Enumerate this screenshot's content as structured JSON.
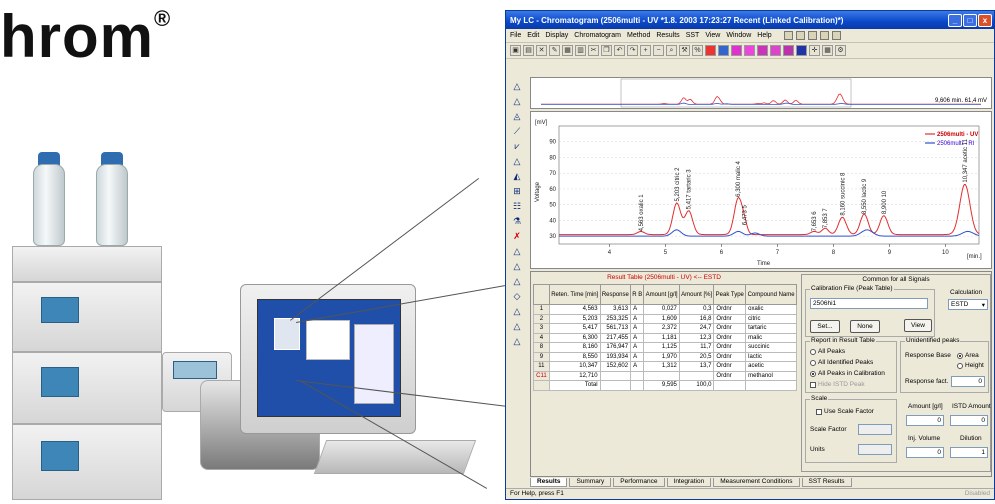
{
  "brand": {
    "text": "hrom",
    "mark": "®"
  },
  "window": {
    "title": "My LC - Chromatogram (2506multi  - UV *1.8. 2003 17:23:27 Recent (Linked Calibration)*)",
    "controls": [
      "_",
      "□",
      "x"
    ]
  },
  "menu": [
    "File",
    "Edit",
    "Display",
    "Chromatogram",
    "Method",
    "Results",
    "SST",
    "View",
    "Window",
    "Help"
  ],
  "overview": {
    "readout": "9,606 min.  61,4 mV"
  },
  "chart_data": {
    "type": "line",
    "ylabel": "Voltage",
    "xlabel": "Time",
    "yunit": "[mV]",
    "xunit": "[min.]",
    "xlim": [
      3.1,
      10.6
    ],
    "ylim": [
      25,
      100
    ],
    "xticks": [
      4,
      5,
      6,
      7,
      8,
      9,
      10
    ],
    "yticks": [
      30,
      40,
      50,
      60,
      70,
      80,
      90
    ],
    "legend": [
      "2506multi - UV",
      "2506multi - RI"
    ],
    "series": [
      {
        "name": "2506multi - UV",
        "color": "#e03030",
        "baseline": 31,
        "peaks": [
          [
            4.563,
            2,
            0.06
          ],
          [
            5.203,
            20,
            0.07
          ],
          [
            5.417,
            15,
            0.07
          ],
          [
            6.3,
            23,
            0.07
          ],
          [
            6.41,
            6,
            0.05
          ],
          [
            7.653,
            2,
            0.06
          ],
          [
            7.853,
            4,
            0.06
          ],
          [
            8.16,
            11,
            0.07
          ],
          [
            8.55,
            13,
            0.07
          ],
          [
            8.9,
            12,
            0.07
          ],
          [
            10.347,
            32,
            0.09
          ]
        ]
      },
      {
        "name": "2506multi - RI",
        "color": "#3050d0",
        "baseline": 30,
        "peaks": [
          [
            5.2,
            4,
            0.08
          ],
          [
            6.3,
            3,
            0.08
          ],
          [
            6.6,
            2,
            0.08
          ],
          [
            8.6,
            4,
            0.1
          ],
          [
            10.4,
            3,
            0.1
          ]
        ]
      }
    ],
    "peak_labels": [
      {
        "x": 4.563,
        "y": 33,
        "text": "4,563 oxalic  1"
      },
      {
        "x": 5.203,
        "y": 52,
        "text": "5,203 citric  2"
      },
      {
        "x": 5.417,
        "y": 47,
        "text": "5,417 tartaric  3"
      },
      {
        "x": 6.3,
        "y": 55,
        "text": "6,300 malic  4"
      },
      {
        "x": 6.41,
        "y": 37,
        "text": "6,473  5"
      },
      {
        "x": 7.653,
        "y": 33,
        "text": "7,653  6"
      },
      {
        "x": 7.853,
        "y": 35,
        "text": "7,853  7"
      },
      {
        "x": 8.16,
        "y": 43,
        "text": "8,160 succinic  8"
      },
      {
        "x": 8.55,
        "y": 44,
        "text": "8,550 lactic  9"
      },
      {
        "x": 8.9,
        "y": 44,
        "text": "8,900  10"
      },
      {
        "x": 10.347,
        "y": 64,
        "text": "10,347 acetic  11"
      }
    ]
  },
  "result_table": {
    "title": "Result Table (2506multi - UV) <-- ESTD",
    "headers": [
      "Reten. Time [min]",
      "Response",
      "R B",
      "Amount [g/l]",
      "Amount [%]",
      "Peak Type",
      "Compound Name"
    ],
    "rows": [
      {
        "idx": "1",
        "cells": [
          "4,563",
          "3,613",
          "A",
          "0,027",
          "0,3",
          "Ordnr",
          "oxalic"
        ]
      },
      {
        "idx": "2",
        "cells": [
          "5,203",
          "253,325",
          "A",
          "1,609",
          "16,8",
          "Ordnr",
          "citric"
        ]
      },
      {
        "idx": "3",
        "cells": [
          "5,417",
          "561,713",
          "A",
          "2,372",
          "24,7",
          "Ordnr",
          "tartaric"
        ]
      },
      {
        "idx": "4",
        "cells": [
          "6,300",
          "217,455",
          "A",
          "1,181",
          "12,3",
          "Ordnr",
          "malic"
        ]
      },
      {
        "idx": "8",
        "cells": [
          "8,160",
          "176,947",
          "A",
          "1,125",
          "11,7",
          "Ordnr",
          "succinic"
        ]
      },
      {
        "idx": "9",
        "cells": [
          "8,550",
          "193,934",
          "A",
          "1,970",
          "20,5",
          "Ordnr",
          "lactic"
        ]
      },
      {
        "idx": "11",
        "cells": [
          "10,347",
          "152,602",
          "A",
          "1,312",
          "13,7",
          "Ordnr",
          "acetic"
        ]
      },
      {
        "idx": "C11",
        "cells": [
          "12,710",
          "",
          "",
          "",
          "",
          "Ordnr",
          "methanol"
        ]
      },
      {
        "idx": "",
        "cells": [
          "Total",
          "",
          "",
          "9,595",
          "100,0",
          "",
          ""
        ]
      }
    ]
  },
  "config": {
    "title": "Common for all Signals",
    "calib_label": "Calibration File (Peak Table)",
    "calib_value": "2506hi1",
    "calc_label": "Calculation",
    "calc_value": "ESTD",
    "set_btn": "Set...",
    "none_btn": "None",
    "view_btn": "View",
    "report_group": "Report in Result Table",
    "report_opts": [
      "All Peaks",
      "All Identified Peaks",
      "All Peaks in Calibration"
    ],
    "hide_istd": "Hide ISTD Peak",
    "unid_group": "Unidentified peaks",
    "resp_base": "Response Base",
    "area": "Area",
    "height": "Height",
    "resp_fact": "Response fact.",
    "resp_fact_val": "0",
    "scale_group": "Scale",
    "use_scale": "Use Scale Factor",
    "scale_factor": "Scale Factor",
    "units": "Units",
    "amount_label": "Amount [g/l]",
    "amount_val": "0",
    "istd_label": "ISTD Amount",
    "istd_val": "0",
    "inj_label": "Inj. Volume",
    "inj_val": "0",
    "dil_label": "Dilution",
    "dil_val": "1"
  },
  "tabs": [
    "Results",
    "Summary",
    "Performance",
    "Integration",
    "Measurement Conditions",
    "SST Results"
  ],
  "status": {
    "left": "For Help, press F1",
    "right": "Disabled"
  }
}
